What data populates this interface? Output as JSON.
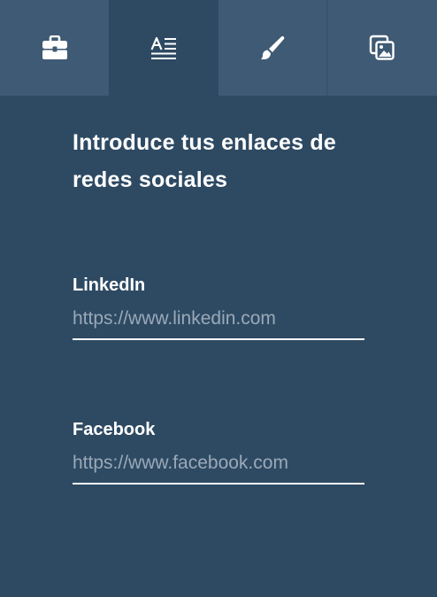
{
  "tabs": [
    {
      "icon": "briefcase-icon",
      "active": false
    },
    {
      "icon": "text-format-icon",
      "active": true
    },
    {
      "icon": "brush-icon",
      "active": false
    },
    {
      "icon": "gallery-icon",
      "active": false
    }
  ],
  "main": {
    "heading": "Introduce tus enlaces de redes sociales"
  },
  "fields": {
    "linkedin": {
      "label": "LinkedIn",
      "value": "",
      "placeholder": "https://www.linkedin.com"
    },
    "facebook": {
      "label": "Facebook",
      "value": "",
      "placeholder": "https://www.facebook.com"
    }
  },
  "colors": {
    "background": "#2e4a63",
    "tab_inactive": "#3f5a74",
    "text": "#ffffff",
    "placeholder": "#9aa9b8"
  }
}
